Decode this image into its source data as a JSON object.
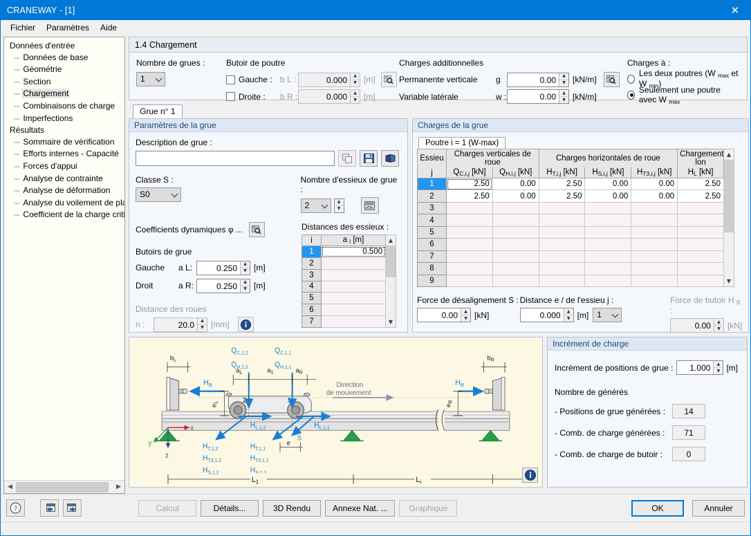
{
  "window": {
    "title": "CRANEWAY - [1]",
    "close_icon": "close-icon"
  },
  "menu": {
    "items": [
      "Fichier",
      "Paramètres",
      "Aide"
    ]
  },
  "tree": {
    "groups": [
      {
        "label": "Données d'entrée",
        "children": [
          "Données de base",
          "Géométrie",
          "Section",
          "Chargement",
          "Combinaisons de charge",
          "Imperfections"
        ]
      },
      {
        "label": "Résultats",
        "children": [
          "Sommaire de vérification",
          "Efforts internes - Capacité",
          "Forces d'appui",
          "Analyse de contrainte",
          "Analyse de déformation",
          "Analyse du voilement de plaque",
          "Coefficient de la charge critique"
        ]
      }
    ],
    "selected": "Chargement"
  },
  "page": {
    "title": "1.4 Chargement"
  },
  "top": {
    "cranes_label": "Nombre de grues :",
    "cranes_value": "1",
    "buffer_group": "Butoir de poutre",
    "left_label": "Gauche :",
    "left_sym": "b L :",
    "left_value": "0.000",
    "left_unit": "[m]",
    "right_label": "Droite :",
    "right_sym": "b R :",
    "right_value": "0.000",
    "right_unit": "[m]",
    "add_loads_title": "Charges additionnelles",
    "perm_label": "Permanente verticale",
    "perm_sym": "g",
    "perm_value": "0.00",
    "perm_unit": "[kN/m]",
    "var_label": "Variable latérale",
    "var_sym": "w :",
    "var_value": "0.00",
    "var_unit": "[kN/m]",
    "loads_at_title": "Charges à :",
    "radio_both": "Les deux poutres (W max et W min)",
    "radio_one": "Seulement une poutre avec W max",
    "radio_selected": "one"
  },
  "crane_tab": {
    "label": "Grue n° 1"
  },
  "params": {
    "group_title": "Paramètres de la grue",
    "desc_label": "Description de grue :",
    "desc_value": "",
    "class_label": "Classe S :",
    "class_value": "S0",
    "axles_label": "Nombre d'essieux de grue :",
    "axles_value": "2",
    "dyn_label": "Coefficients dynamiques φ ...",
    "buffers_title": "Butoirs de grue",
    "left_label": "Gauche",
    "left_sym": "a L:",
    "left_value": "0.250",
    "right_label": "Droit",
    "right_sym": "a R:",
    "right_value": "0.250",
    "unit_m": "[m]",
    "wheel_dist_label": "Distance des roues",
    "wheel_dist_sym": "n :",
    "wheel_dist_value": "20.0",
    "wheel_dist_unit": "[mm]",
    "axle_dist_label": "Distances des essieux :",
    "axle_table": {
      "headers": [
        "i",
        "a i [m]"
      ],
      "rows": [
        {
          "i": "1",
          "a": "0.500"
        },
        {
          "i": "2",
          "a": ""
        },
        {
          "i": "3",
          "a": ""
        },
        {
          "i": "4",
          "a": ""
        },
        {
          "i": "5",
          "a": ""
        },
        {
          "i": "6",
          "a": ""
        },
        {
          "i": "7",
          "a": ""
        }
      ],
      "selected_row": 0
    }
  },
  "loads": {
    "group_title": "Charges de la grue",
    "tab_label": "Poutre i = 1 (W-max)",
    "table": {
      "group_headers": [
        {
          "label": "Essieu",
          "span": 1
        },
        {
          "label": "Charges verticales de roue",
          "span": 2
        },
        {
          "label": "Charges horizontales de roue",
          "span": 3
        },
        {
          "label": "Chargement lon",
          "span": 1
        }
      ],
      "sub_headers": [
        "j",
        "Q C,i,j [kN]",
        "Q H,i,j [kN]",
        "H T,i,j [kN]",
        "H S,i,j [kN]",
        "H T3,i,j [kN]",
        "H L [kN]"
      ],
      "rows": [
        {
          "j": "1",
          "values": [
            "2.50",
            "0.00",
            "2.50",
            "0.00",
            "0.00",
            "2.50"
          ]
        },
        {
          "j": "2",
          "values": [
            "2.50",
            "0.00",
            "2.50",
            "0.00",
            "0.00",
            "2.50"
          ]
        },
        {
          "j": "3",
          "values": [
            "",
            "",
            "",
            "",
            "",
            ""
          ]
        },
        {
          "j": "4",
          "values": [
            "",
            "",
            "",
            "",
            "",
            ""
          ]
        },
        {
          "j": "5",
          "values": [
            "",
            "",
            "",
            "",
            "",
            ""
          ]
        },
        {
          "j": "6",
          "values": [
            "",
            "",
            "",
            "",
            "",
            ""
          ]
        },
        {
          "j": "7",
          "values": [
            "",
            "",
            "",
            "",
            "",
            ""
          ]
        },
        {
          "j": "8",
          "values": [
            "",
            "",
            "",
            "",
            "",
            ""
          ]
        },
        {
          "j": "9",
          "values": [
            "",
            "",
            "",
            "",
            "",
            ""
          ]
        }
      ],
      "selected_row": 0
    },
    "skew_label": "Force de désalignement S :",
    "skew_value": "0.00",
    "skew_unit": "[kN]",
    "dist_label": "Distance e / de l'essieu j :",
    "dist_value": "0.000",
    "dist_unit": "[m]",
    "dist_axle": "1",
    "buffer_force_label": "Force de butoir H B :",
    "buffer_force_value": "0.00",
    "buffer_force_unit": "[kN]"
  },
  "increment": {
    "group_title": "Incrément de charge",
    "step_label": "Incrément de positions de grue :",
    "step_value": "1.000",
    "step_unit": "[m]",
    "generated_title": "Nombre de générés",
    "rows": [
      {
        "label": "- Positions de grue générées :",
        "value": "14"
      },
      {
        "label": "- Comb. de charge générées :",
        "value": "71"
      },
      {
        "label": "- Comb. de charge de butoir :",
        "value": "0"
      }
    ]
  },
  "diagram": {
    "labels": {
      "bL": "b",
      "bL_sub": "L",
      "bR": "b",
      "bR_sub": "R",
      "aL": "a",
      "aL_sub": "L",
      "a1": "a",
      "a1_sub": "1",
      "aR": "a",
      "aR_sub": "R",
      "qc12": "Q",
      "qc12_sub": "C,1,2",
      "qc11": "Q",
      "qc11_sub": "C,1,1",
      "qh12": "Q",
      "qh12_sub": "H,1,2",
      "qh11": "Q",
      "qh11_sub": "H,1,1",
      "hb": "H",
      "hb_sub": "B",
      "eL": "e",
      "eL_sub": "L",
      "eR": "e",
      "eR_sub": "R",
      "hl12": "H",
      "hl12_sub": "L,1,2",
      "hl11": "H",
      "hl11_sub": "L,1,1",
      "ht12": "H",
      "ht12_sub": "T,1,2",
      "ht11": "H",
      "ht11_sub": "T,1,1",
      "ht312": "H",
      "ht312_sub": "T3,1,2",
      "ht311": "H",
      "ht311_sub": "T3,1,1",
      "hs12": "H",
      "hs12_sub": "S,1,2",
      "hs11": "H",
      "hs11_sub": "S,1,1",
      "S": "S",
      "e": "e",
      "L1": "L",
      "L1_sub": "1",
      "Li": "L",
      "Li_sub": "i",
      "wheel2": "2",
      "wheel1": "1",
      "axis_x": "x",
      "axis_y": "y",
      "axis_z": "z",
      "direction_line1": "Direction",
      "direction_line2": "de mouvement"
    },
    "info_icon": "info-icon"
  },
  "toolbar": {
    "help_icon": "help-icon",
    "prev_icon": "previous-icon",
    "next_icon": "next-icon"
  },
  "buttons": {
    "calcul": "Calcul",
    "details": "Détails...",
    "render3d": "3D Rendu",
    "annexe": "Annexe Nat. ...",
    "graphique": "Graphique",
    "ok": "OK",
    "annuler": "Annuler"
  },
  "colors": {
    "title_bar": "#0078d7",
    "accent_blue": "#1a7fd4",
    "diagram_bg": "#fdf8e3",
    "panel_bg": "#f4f7fb",
    "selection": "#2196f3",
    "support_green": "#2e9e4f"
  }
}
